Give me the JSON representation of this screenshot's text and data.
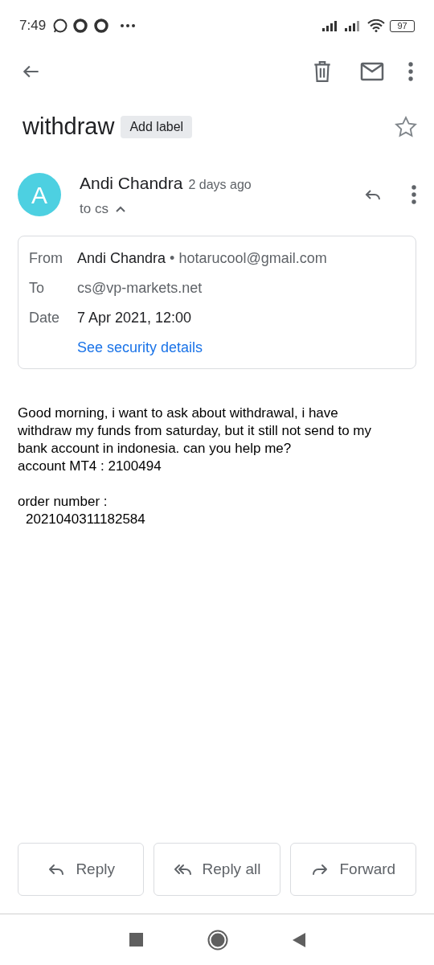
{
  "status_bar": {
    "time": "7:49",
    "battery": "97"
  },
  "subject": {
    "title": "withdraw",
    "label_button": "Add label",
    "starred": false
  },
  "message": {
    "avatar_letter": "A",
    "sender": "Andi Chandra",
    "time": "2 days ago",
    "recipient_summary": "to cs",
    "details_expanded": true,
    "details": [
      {
        "label": "From",
        "value": "Andi Chandra",
        "extra": "• hotarucool@gmail.com"
      },
      {
        "label": "To",
        "value": "cs@vp-markets.net"
      },
      {
        "label": "Date",
        "value": "7 Apr 2021, 12:00"
      }
    ],
    "security_link": "See security details",
    "body": [
      {
        "lines": [
          "Good morning, i want to ask about withdrawal, i have",
          "withdraw my funds from saturday, but it still not send to my",
          "bank account in indonesia. can you help me?",
          "account MT4 : 2100494"
        ]
      },
      {
        "lines": [
          "order number :",
          "2021040311182584"
        ]
      }
    ]
  },
  "actions": [
    {
      "kind": "reply",
      "label": "Reply"
    },
    {
      "kind": "reply_all",
      "label": "Reply all"
    },
    {
      "kind": "forward",
      "label": "Forward"
    }
  ]
}
